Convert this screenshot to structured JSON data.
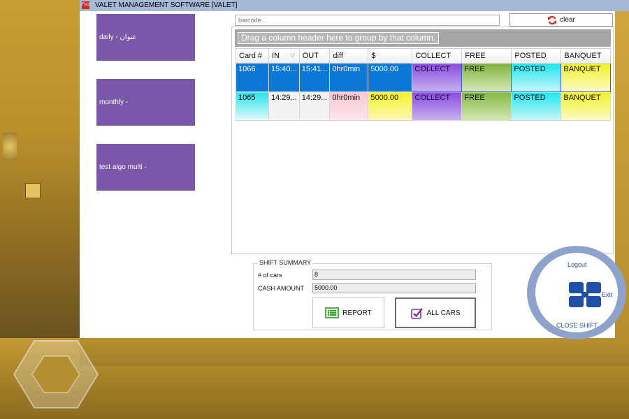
{
  "window": {
    "title": "VALET MANAGEMENT SOFTWARE [VALET]",
    "icon_label": "Fecc"
  },
  "categories": [
    {
      "label": "daily - عنوان"
    },
    {
      "label": "monthly -"
    },
    {
      "label": "test algo multi -"
    }
  ],
  "search": {
    "placeholder": "barcode...",
    "clear_label": "clear"
  },
  "grid": {
    "group_hint": "Drag a column header here to group by that column.",
    "columns": [
      "Card #",
      "IN",
      "OUT",
      "diff",
      "$",
      "COLLECT",
      "FREE",
      "POSTED",
      "BANQUET"
    ],
    "rows": [
      {
        "card": "1066",
        "in": "15:40...",
        "out": "15:41...",
        "diff": "0hr0min",
        "amount": "5000.00",
        "collect": "COLLECT",
        "free": "FREE",
        "posted": "POSTED",
        "banquet": "BANQUET"
      },
      {
        "card": "1065",
        "in": "14:29...",
        "out": "14:29...",
        "diff": "0hr0min",
        "amount": "5000.00",
        "collect": "COLLECT",
        "free": "FREE",
        "posted": "POSTED",
        "banquet": "BANQUET"
      }
    ]
  },
  "summary": {
    "title": "SHIFT SUMMARY",
    "cars_label": "# of cars",
    "cars_value": "8",
    "cash_label": "CASH AMOUNT",
    "cash_value": "5000.00",
    "report_label": "REPORT",
    "all_cars_label": "ALL CARS"
  },
  "session": {
    "logout_label": "Logout",
    "exit_label": "Exit",
    "close_shift_label": "CLOSE SHIFT"
  },
  "colors": {
    "tile": "#7a57a8",
    "selection": "#0a78d4",
    "titlebar": "#a6b9d6",
    "accent_blue": "#2a4f9e"
  }
}
